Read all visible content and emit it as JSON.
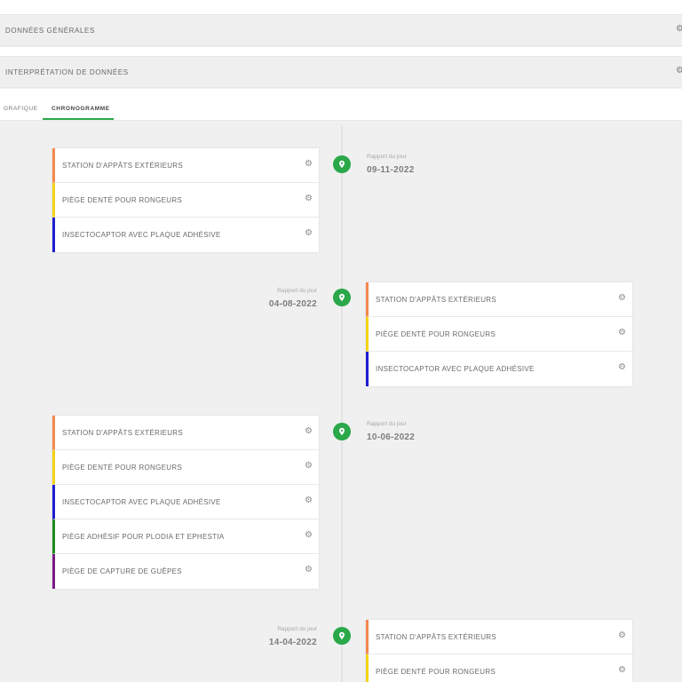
{
  "accordions": [
    {
      "title": "DONNÉES GÉNÉRALES",
      "icon": "gear-icon"
    },
    {
      "title": "INTERPRÉTATION DE DONNÉES",
      "icon": "gear-icon"
    }
  ],
  "tabs": [
    {
      "label": "GRAFIQUE",
      "active": false
    },
    {
      "label": "CHRONOGRAMME",
      "active": true
    }
  ],
  "colors": {
    "accent": "#2aa84a",
    "orange": "#f5884e",
    "yellow": "#f4d316",
    "blue": "#1d1dd0",
    "green": "#1f8a1f",
    "purple": "#7a1a86"
  },
  "gear_glyph": "⚙",
  "timeline": [
    {
      "caption": "Rapport du jour",
      "date": "09-11-2022",
      "items": [
        {
          "label": "STATION D'APPÂTS EXTÉRIEURS",
          "color": "orange"
        },
        {
          "label": "PIÈGE DENTÉ POUR RONGEURS",
          "color": "yellow"
        },
        {
          "label": "INSECTOCAPTOR AVEC PLAQUE ADHÉSIVE",
          "color": "blue"
        }
      ]
    },
    {
      "caption": "Rapport du jour",
      "date": "04-08-2022",
      "items": [
        {
          "label": "STATION D'APPÂTS EXTÉRIEURS",
          "color": "orange"
        },
        {
          "label": "PIÈGE DENTÉ POUR RONGEURS",
          "color": "yellow"
        },
        {
          "label": "INSECTOCAPTOR AVEC PLAQUE ADHÉSIVE",
          "color": "blue"
        }
      ]
    },
    {
      "caption": "Rapport du jour",
      "date": "10-06-2022",
      "items": [
        {
          "label": "STATION D'APPÂTS EXTÉRIEURS",
          "color": "orange"
        },
        {
          "label": "PIÈGE DENTÉ POUR RONGEURS",
          "color": "yellow"
        },
        {
          "label": "INSECTOCAPTOR AVEC PLAQUE ADHÉSIVE",
          "color": "blue"
        },
        {
          "label": "PIÈGE ADHÉSIF POUR PLODIA ET EPHESTIA",
          "color": "green"
        },
        {
          "label": "PIÈGE DE CAPTURE DE GUÊPES",
          "color": "purple"
        }
      ]
    },
    {
      "caption": "Rapport du jour",
      "date": "14-04-2022",
      "items": [
        {
          "label": "STATION D'APPÂTS EXTÉRIEURS",
          "color": "orange"
        },
        {
          "label": "PIÈGE DENTÉ POUR RONGEURS",
          "color": "yellow"
        }
      ]
    }
  ]
}
